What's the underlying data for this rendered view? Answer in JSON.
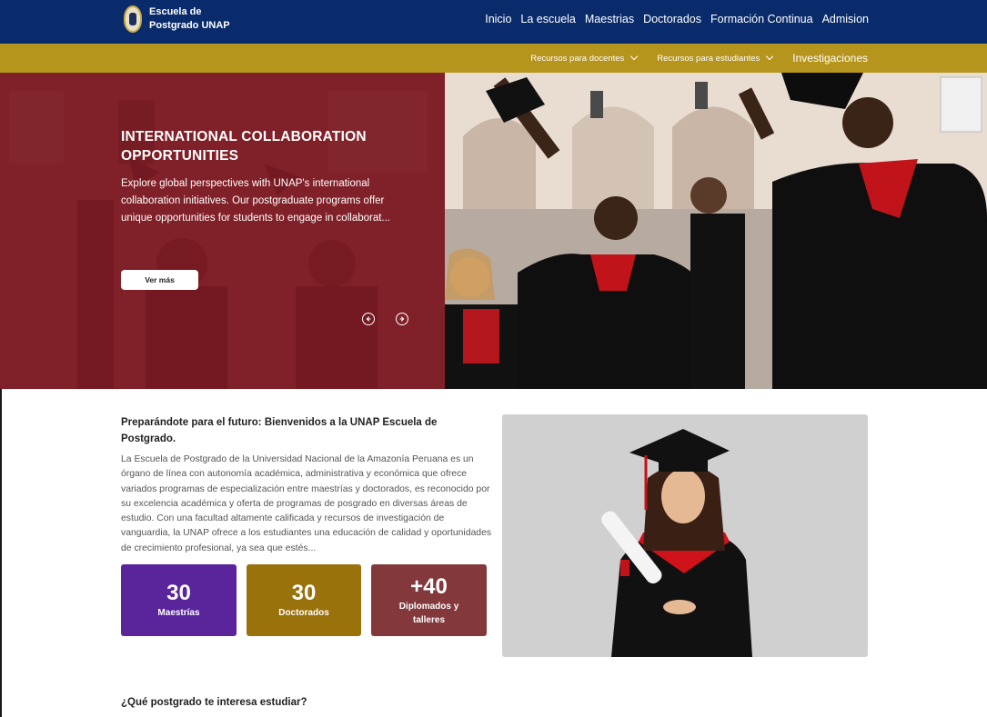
{
  "header": {
    "brand": "Escuela de Postgrado UNAP",
    "nav": [
      "Inicio",
      "La escuela",
      "Maestrias",
      "Doctorados",
      "Formación Continua",
      "Admision"
    ]
  },
  "subnav": {
    "items": [
      "Recursos para docentes",
      "Recursos para estudiantes",
      "Investigaciones"
    ]
  },
  "hero": {
    "title": "INTERNATIONAL COLLABORATION OPPORTUNITIES",
    "description": "Explore global perspectives with UNAP's international collaboration initiatives. Our postgraduate programs offer unique opportunities for students to engage in collaborat...",
    "button": "Ver más"
  },
  "welcome": {
    "title": "Preparándote para el futuro: Bienvenidos a la UNAP Escuela de Postgrado.",
    "text": "La Escuela de Postgrado de la Universidad Nacional de la Amazonía Peruana es un órgano de línea con autonomía académica, administrativa y económica que ofrece variados programas de especialización entre maestrías y doctorados, es reconocido por su excelencia académica y oferta de programas de posgrado en diversas áreas de estudio. Con una facultad altamente calificada y recursos de investigación de vanguardia, la UNAP ofrece a los estudiantes una educación de calidad y oportunidades de crecimiento profesional, ya sea que estés..."
  },
  "stats": [
    {
      "value": "30",
      "label": "Maestrías",
      "color": "#5a249b"
    },
    {
      "value": "30",
      "label": "Doctorados",
      "color": "#9a720c"
    },
    {
      "value": "+40",
      "label": "Diplomados y talleres",
      "color": "#83383c"
    }
  ],
  "question": "¿Qué postgrado te interesa estudiar?",
  "colors": {
    "navy": "#0a2b6b",
    "gold": "#b6951d",
    "hero_overlay": "#801a24"
  }
}
